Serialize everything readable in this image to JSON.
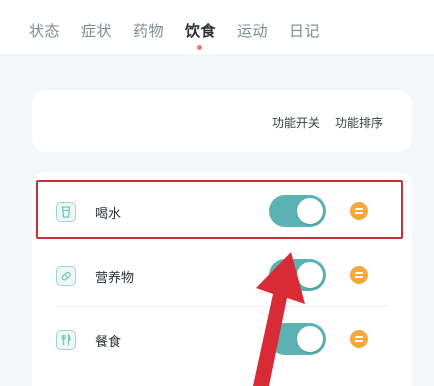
{
  "tabs": [
    {
      "label": "状态"
    },
    {
      "label": "症状"
    },
    {
      "label": "药物"
    },
    {
      "label": "饮食",
      "active": true
    },
    {
      "label": "运动"
    },
    {
      "label": "日记"
    }
  ],
  "columns": {
    "toggle_label": "功能开关",
    "sort_label": "功能排序"
  },
  "items": [
    {
      "label": "喝水",
      "icon": "cup-icon",
      "enabled": true,
      "highlighted": true
    },
    {
      "label": "营养物",
      "icon": "pill-icon",
      "enabled": true
    },
    {
      "label": "餐食",
      "icon": "utensils-icon",
      "enabled": true
    }
  ],
  "colors": {
    "accent": "#5cb2b3",
    "sort_button": "#f2a93c",
    "annotation": "#d92b36",
    "active_dot": "#f07a68"
  }
}
